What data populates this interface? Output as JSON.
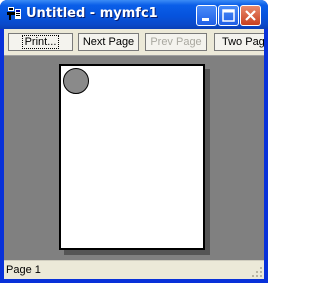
{
  "window": {
    "title": "Untitled - mymfc1",
    "app_icon": "mfc-app-icon",
    "controls": [
      "minimize-icon",
      "maximize-icon",
      "close-icon"
    ]
  },
  "toolbar": {
    "print_label": "Print...",
    "next_page_label": "Next Page",
    "prev_page_label": "Prev Page",
    "two_page_label": "Two Pag"
  },
  "preview": {
    "background": "#808080",
    "page_color": "#ffffff",
    "circle_color": "#8a8a8a"
  },
  "statusbar": {
    "page_label": "Page 1"
  }
}
